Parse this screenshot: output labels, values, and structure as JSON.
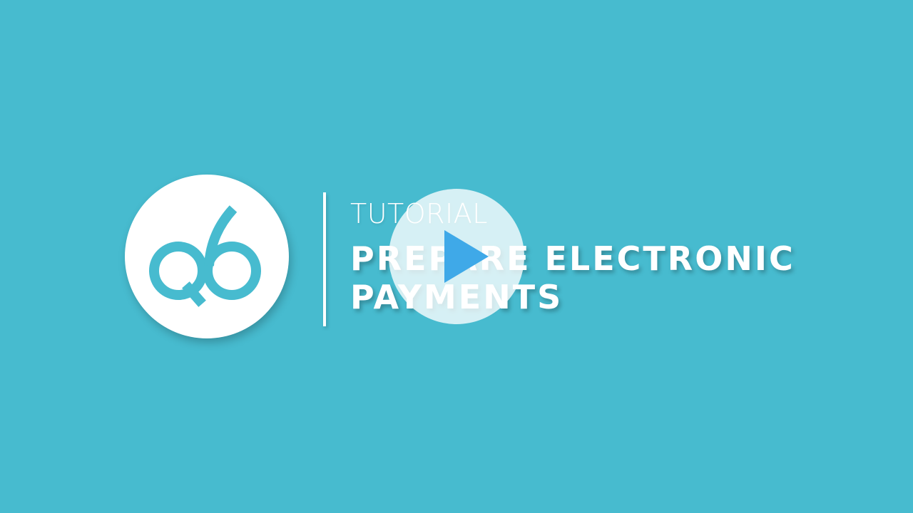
{
  "slide": {
    "eyebrow": "TUTORIAL",
    "title_line1": "PREPARE ELECTRONIC",
    "title_line2": "PAYMENTS"
  },
  "logo": {
    "icon": "q6-logo-icon",
    "mark_text": "q6"
  },
  "player": {
    "play_icon": "play-icon"
  },
  "colors": {
    "background": "#47BBCF",
    "logo_circle": "#FFFFFF",
    "logo_mark": "#47BBCF",
    "text": "#FFFFFF",
    "play_overlay": "#FFFFFF",
    "play_triangle": "#3FA9E8"
  }
}
